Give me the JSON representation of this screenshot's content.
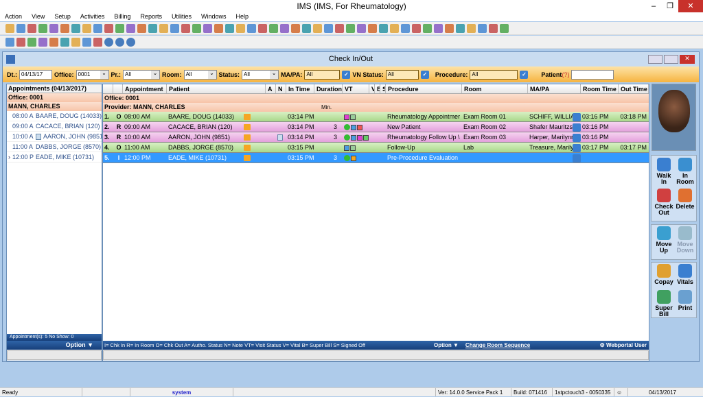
{
  "app": {
    "title": "IMS (IMS, For Rheumatology)"
  },
  "menu": [
    "Action",
    "View",
    "Setup",
    "Activities",
    "Billing",
    "Reports",
    "Utilities",
    "Windows",
    "Help"
  ],
  "window": {
    "title": "Check In/Out"
  },
  "filters": {
    "dt_label": "Dt.:",
    "dt": "04/13/17",
    "office_label": "Office:",
    "office": "0001",
    "pr_label": "Pr.:",
    "pr": "All",
    "room_label": "Room:",
    "room": "All",
    "status_label": "Status:",
    "status": "All",
    "mapa_label": "MA/PA:",
    "mapa": "All",
    "vn_label": "VN Status:",
    "vn": "All",
    "procedure_label": "Procedure:",
    "procedure": "All",
    "patient_label": "Patient",
    "patient_help": "(?)",
    "patient": ""
  },
  "left": {
    "title": "Appointments (04/13/2017)",
    "office": "Office: 0001",
    "provider": "MANN, CHARLES",
    "items": [
      {
        "time": "08:00 A",
        "name": "BAARE, DOUG  (14033)"
      },
      {
        "time": "09:00 A",
        "name": "CACACE, BRIAN  (120)"
      },
      {
        "time": "10:00 A",
        "name": "AARON, JOHN  (9851"
      },
      {
        "time": "11:00 A",
        "name": "DABBS, JORGE  (8570)"
      },
      {
        "time": "12:00 P",
        "name": "EADE, MIKE  (10731)"
      }
    ],
    "summary": "Appointment(s): 5   No Show: 0",
    "option": "Option ▼"
  },
  "grid": {
    "columns": [
      "",
      "",
      "Appointment",
      "Patient",
      "A",
      "N",
      "In Time",
      "Duration",
      "VT",
      "V",
      "B",
      "S",
      "Procedure",
      "Room",
      "MA/PA",
      "Room Time",
      "Out Time"
    ],
    "office": "Office: 0001",
    "provider": "Provider: MANN, CHARLES",
    "min_label": "Min.",
    "rows": [
      {
        "num": "1.",
        "status": "O",
        "appt": "08:00 AM",
        "patient": "BAARE, DOUG  (14033)",
        "note": false,
        "in_time": "03:14 PM",
        "duration": "",
        "smile": false,
        "procedure": "Rheumatology Appointmer",
        "room": "Exam Room 01",
        "mapa": "SCHIFF, WILLIA",
        "room_time": "03:16 PM",
        "out_time": "03:18 PM",
        "color": "green"
      },
      {
        "num": "2.",
        "status": "R",
        "appt": "09:00 AM",
        "patient": "CACACE, BRIAN  (120)",
        "note": false,
        "in_time": "03:14 PM",
        "duration": "3",
        "smile": true,
        "procedure": "New Patient",
        "room": "Exam Room 02",
        "mapa": "Shafer Mauritzss",
        "room_time": "03:16 PM",
        "out_time": "",
        "color": "pink"
      },
      {
        "num": "3.",
        "status": "R",
        "appt": "10:00 AM",
        "patient": "AARON, JOHN  (9851)",
        "note": true,
        "in_time": "03:14 PM",
        "duration": "3",
        "smile": true,
        "procedure": "Rheumatology Follow Up \\",
        "room": "Exam Room 03",
        "mapa": "Harper, Marilynn",
        "room_time": "03:16 PM",
        "out_time": "",
        "color": "pink"
      },
      {
        "num": "4.",
        "status": "O",
        "appt": "11:00 AM",
        "patient": "DABBS, JORGE  (8570)",
        "note": false,
        "in_time": "03:15 PM",
        "duration": "",
        "smile": false,
        "procedure": "Follow-Up",
        "room": "Lab",
        "mapa": "Treasure, Marilyr",
        "room_time": "03:17 PM",
        "out_time": "03:17 PM",
        "color": "green"
      },
      {
        "num": "5.",
        "status": "I",
        "appt": "12:00 PM",
        "patient": "EADE, MIKE  (10731)",
        "note": false,
        "in_time": "03:15 PM",
        "duration": "3",
        "smile": true,
        "procedure": "Pre-Procedure Evaluation",
        "room": "",
        "mapa": "",
        "room_time": "",
        "out_time": "",
        "color": "selected"
      }
    ],
    "legend": "I= Chk In  R= In Room O= Chk Out  A= Autho. Status  N= Note  VT= Visit Status  V= Vital  B= Super Bill  S= Signed Off",
    "option": "Option ▼",
    "change_room": "Change Room Sequence",
    "webportal": "Webportal User"
  },
  "actions": [
    [
      "Walk",
      "In"
    ],
    [
      "In",
      "Room"
    ],
    [
      "Check",
      "Out"
    ],
    [
      "Delete",
      ""
    ],
    [
      "Move",
      "Up"
    ],
    [
      "Move",
      "Down"
    ],
    [
      "Copay",
      ""
    ],
    [
      "Vitals",
      ""
    ],
    [
      "Super",
      "Bill"
    ],
    [
      "Print",
      ""
    ]
  ],
  "statusbar": {
    "ready": "Ready",
    "user": "system",
    "version": "Ver: 14.0.0 Service Pack 1",
    "build": "Build: 071416",
    "station": "1stpctouch3 - 0050335",
    "date": "04/13/2017"
  }
}
